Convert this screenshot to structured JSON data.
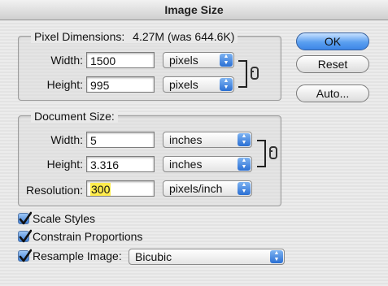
{
  "window": {
    "title": "Image Size"
  },
  "pixel_dimensions": {
    "title": "Pixel Dimensions:",
    "size_text": "4.27M (was 644.6K)",
    "width_label": "Width:",
    "width_value": "1500",
    "width_unit": "pixels",
    "height_label": "Height:",
    "height_value": "995",
    "height_unit": "pixels"
  },
  "document_size": {
    "title": "Document Size:",
    "width_label": "Width:",
    "width_value": "5",
    "width_unit": "inches",
    "height_label": "Height:",
    "height_value": "3.316",
    "height_unit": "inches",
    "resolution_label": "Resolution:",
    "resolution_value": "300",
    "resolution_unit": "pixels/inch"
  },
  "options": {
    "scale_styles": {
      "label": "Scale Styles",
      "checked": true
    },
    "constrain_proportions": {
      "label": "Constrain Proportions",
      "checked": true
    },
    "resample_image": {
      "label": "Resample Image:",
      "checked": true,
      "method": "Bicubic"
    }
  },
  "buttons": {
    "ok": "OK",
    "reset": "Reset",
    "auto": "Auto..."
  },
  "icons": {
    "dropdown": "updown-arrows-icon",
    "link": "chain-link-icon",
    "check": "checkmark-icon"
  },
  "colors": {
    "highlight": "#ffec4d",
    "accent": "#3d86e6"
  }
}
